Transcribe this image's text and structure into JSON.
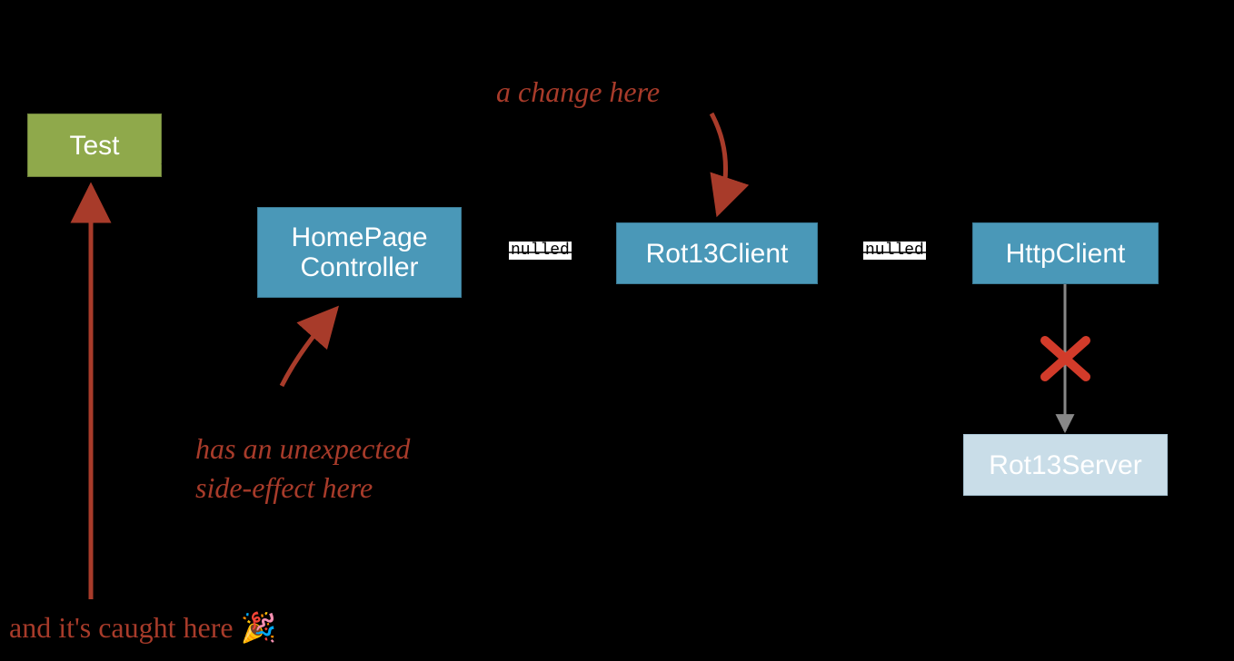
{
  "nodes": {
    "test": "Test",
    "homepage": "HomePage\nController",
    "rot13client": "Rot13Client",
    "httpclient": "HttpClient",
    "rot13server": "Rot13Server"
  },
  "edgeLabels": {
    "hp_to_client": "nulled",
    "client_to_http": "nulled"
  },
  "annotations": {
    "change": "a change here",
    "sideEffect": "has an unexpected\nside-effect here",
    "caught": "and it's caught here 🎉"
  }
}
